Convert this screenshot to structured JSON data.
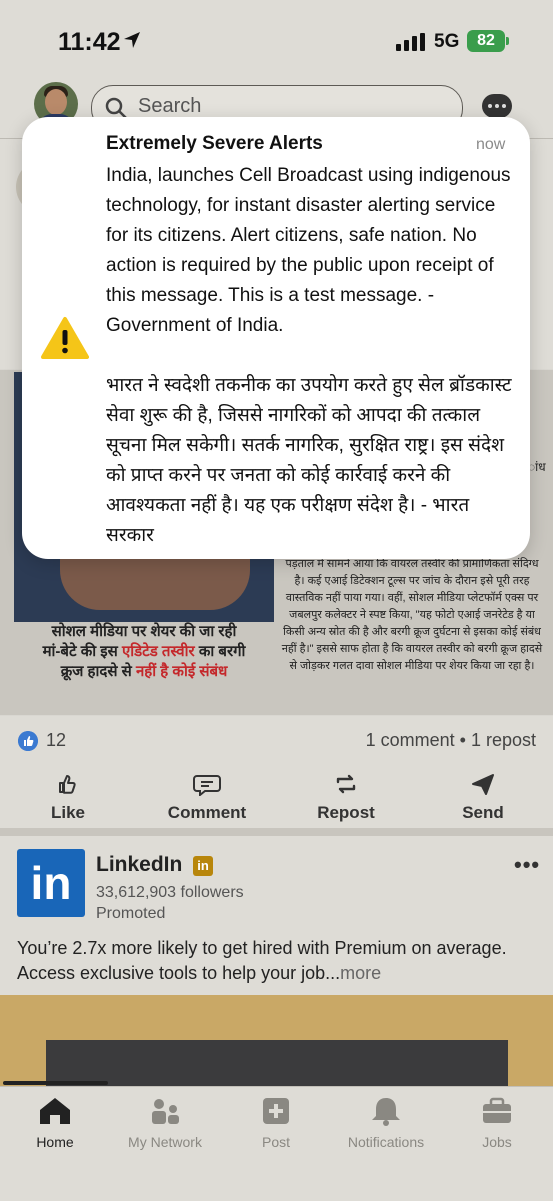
{
  "status_bar": {
    "time": "11:42",
    "network": "5G",
    "battery": "82"
  },
  "header": {
    "search_placeholder": "Search"
  },
  "post": {
    "image_caption_line1": "सोशल मीडिया पर शेयर की जा रही",
    "image_caption_line2_a": "मां-बेटे की इस ",
    "image_caption_line2_b": "एडिटेड तस्वीर",
    "image_caption_line2_c": " का बरगी",
    "image_caption_line3_a": "क्रूज हादसे से ",
    "image_caption_line3_b": "नहीं है कोई संबंध",
    "image_right_text": "पड़ताल में सामने आया कि वायरल तस्वीर की प्रामाणिकता संदिग्ध है। कई एआई डिटेक्शन टूल्स पर जांच के दौरान इसे पूरी तरह वास्तविक नहीं पाया गया। वहीं, सोशल मीडिया प्लेटफॉर्म एक्स पर जबलपुर कलेक्टर ने स्पष्ट किया, \"यह फोटो एआई जनरेटेड है या किसी अन्य स्रोत की है और बरगी क्रूज दुर्घटना से इसका कोई संबंध नहीं है।\" इससे साफ होता है कि वायरल तस्वीर को बरगी क्रूज हादसे से जोड़कर गलत दावा सोशल मीडिया पर शेयर किया जा रहा है।",
    "image_right_top": "ांध",
    "likes": "12",
    "comments": "1 comment • 1 repost"
  },
  "actions": {
    "like": "Like",
    "comment": "Comment",
    "repost": "Repost",
    "send": "Send"
  },
  "ad": {
    "logo_text": "in",
    "name": "LinkedIn",
    "badge": "in",
    "followers": "33,612,903 followers",
    "promoted": "Promoted",
    "text": "You’re 2.7x more likely to get hired with Premium on average. Access exclusive tools to help your job...",
    "more": "more",
    "menu": "•••"
  },
  "bottom_nav": {
    "home": "Home",
    "network": "My Network",
    "post": "Post",
    "notifications": "Notifications",
    "jobs": "Jobs"
  },
  "notification": {
    "title": "Extremely Severe Alerts",
    "time": "now",
    "body_en": "India, launches Cell Broadcast using indigenous technology, for instant disaster alerting service for its citizens. Alert citizens, safe nation. No action is required by the public upon receipt of this message. This is a test message. - Government of India.",
    "body_hi": "भारत ने स्वदेशी तकनीक का उपयोग करते हुए सेल ब्रॉडकास्ट सेवा शुरू की है, जिससे नागरिकों को आपदा की तत्काल सूचना मिल सकेगी। सतर्क नागरिक, सुरक्षित राष्ट्र। इस संदेश को प्राप्त करने पर जनता को कोई कार्रवाई करने की आवश्यकता नहीं है। यह एक परीक्षण संदेश है। - भारत सरकार"
  },
  "colors": {
    "linkedin_blue": "#1966b8",
    "alert_yellow": "#f5c518",
    "battery_green": "#3a9d4c"
  }
}
